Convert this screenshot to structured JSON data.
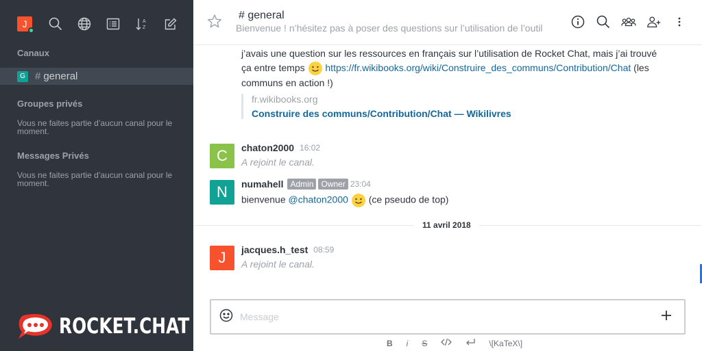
{
  "sidebar": {
    "user_initial": "J",
    "sections": {
      "channels_title": "Canaux",
      "private_groups_title": "Groupes privés",
      "private_groups_empty": "Vous ne faites partie d’aucun canal pour le moment.",
      "direct_messages_title": "Messages Privés",
      "direct_messages_empty": "Vous ne faites partie d’aucun canal pour le moment."
    },
    "channels": [
      {
        "initial": "G",
        "name": "general"
      }
    ],
    "logo_text": "ROCKET.CHAT"
  },
  "header": {
    "room_name": "general",
    "topic": "Bienvenue ! n’hésitez pas à poser des questions sur l’utilisation de l’outil"
  },
  "messages": {
    "continued_text_1": "j’avais une question sur les ressources en français sur l’utilisation de Rocket Chat, mais j’ai trouvé",
    "continued_text_2a": "ça entre temps",
    "continued_link": "https://fr.wikibooks.org/wiki/Construire_des_communs/Contribution/Chat",
    "continued_text_2b": "(les",
    "continued_text_3": "communs en action !)",
    "quote_site": "fr.wikibooks.org",
    "quote_title": "Construire des communs/Contribution/Chat — Wikilivres",
    "items": [
      {
        "initial": "C",
        "color": "#8bc34a",
        "user": "chaton2000",
        "time": "16:02",
        "body": "A rejoint le canal."
      },
      {
        "initial": "N",
        "color": "#12a195",
        "user": "numahell",
        "roles": [
          "Admin",
          "Owner"
        ],
        "time": "23:04",
        "body_prefix": "bienvenue",
        "mention": "@chaton2000",
        "body_suffix": "(ce pseudo de top)"
      },
      {
        "initial": "J",
        "color": "#f5522d",
        "user": "jacques.h_test",
        "time": "08:59",
        "body": "A rejoint le canal."
      }
    ],
    "date_divider": "11 avril 2018"
  },
  "composer": {
    "placeholder": "Message",
    "format_bold": "B",
    "format_italic": "i",
    "format_strike": "S",
    "format_katex": "\\[KaTeX\\]"
  }
}
